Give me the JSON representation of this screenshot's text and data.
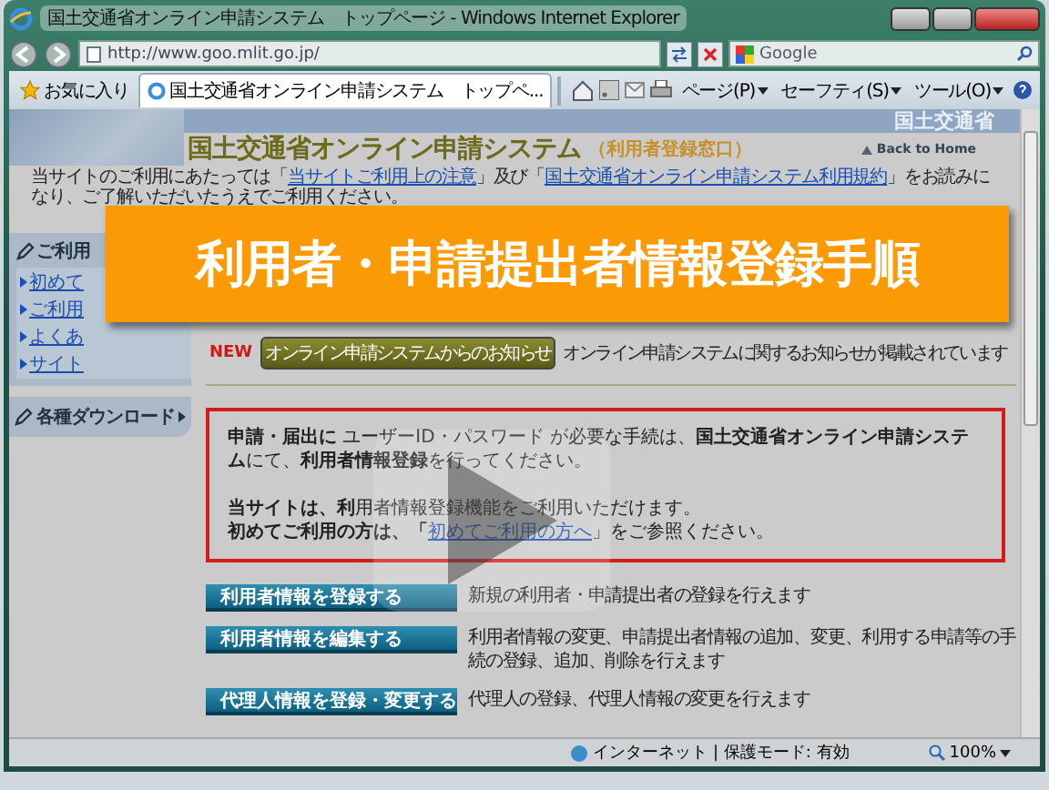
{
  "window": {
    "title": "国土交通省オンライン申請システム　トップページ - Windows Internet Explorer"
  },
  "address_bar": {
    "url": "http://www.goo.mlit.go.jp/"
  },
  "search_box": {
    "placeholder": "Google"
  },
  "favorites": "お気に入り",
  "tabs": [
    {
      "label": "国土交通省オンライン申請システム　トップペ...",
      "selected": true
    }
  ],
  "command_bar": [
    "ページ(P)",
    "セーフティ(S)",
    "ツール(O)"
  ],
  "page": {
    "agency": "国土交通省",
    "title": "国土交通省オンライン申請システム",
    "subtitle": "（利用者登録窓口）",
    "back_link": "Back to Home",
    "notice": [
      {
        "kind": "text",
        "text": "当サイトのご利用にあたっては「"
      },
      {
        "kind": "link",
        "text": "当サイトご利用上の注意"
      },
      {
        "kind": "text",
        "text": "」及び「"
      },
      {
        "kind": "link",
        "text": "国土交通省オンライン申請システム利用規約"
      },
      {
        "kind": "text",
        "text": "」をお読みになり、ご了解いただいたうえでご利用ください。"
      }
    ],
    "sidebar": {
      "heading": "ご利用",
      "items": [
        "初めて",
        "ご利用",
        "よくあ",
        "サイト"
      ],
      "downloads": "各種ダウンロード"
    },
    "news": {
      "badge": "NEW",
      "button": "オンライン申請システムからのお知らせ",
      "text": "オンライン申請システムに関するお知らせが掲載されています"
    },
    "info_box": [
      "**申請・届出に** ユーザーID・パスワード が必要な手続は、**国土交通省オンライン申請システム**にて、**利用者情報登録**を行ってください。",
      "**当サイトは、利**用者情報登録機能をご利用いただけます。"
    ],
    "info_link": {
      "before": "初めてご利用の方は、「",
      "link": "初めてご利用の方へ",
      "after": "」をご参照ください。"
    },
    "actions": [
      {
        "button": "利用者情報を登録する",
        "description": "新規の利用者・申請提出者の登録を行えます"
      },
      {
        "button": "利用者情報を編集する",
        "description": "利用者情報の変更、申請提出者情報の追加、変更、利用する申請等の手続の登録、追加、削除を行えます"
      },
      {
        "button": "代理人情報を登録・変更する",
        "description": "代理人の登録、代理人情報の変更を行えます"
      }
    ]
  },
  "status_bar": {
    "zone": "インターネット | 保護モード: 有効",
    "zoom": "100%"
  },
  "video_overlay": {
    "title": "利用者・申請提出者情報登録手順"
  }
}
